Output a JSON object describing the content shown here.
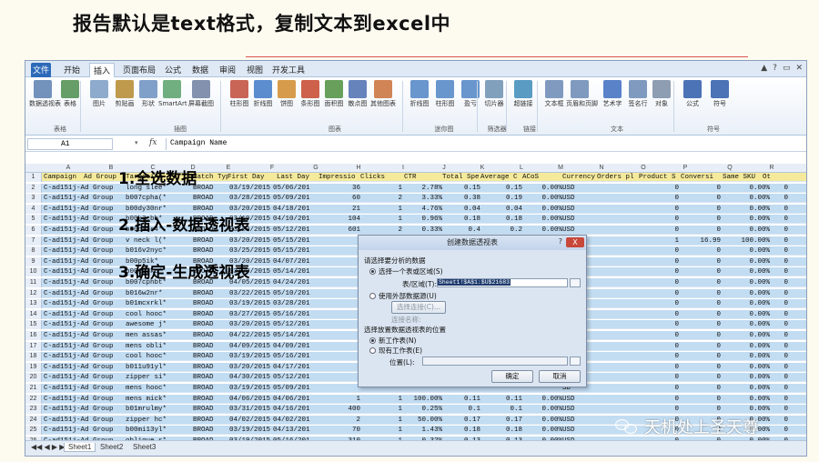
{
  "slide": {
    "title": "报告默认是text格式，复制文本到excel中",
    "steps": [
      "1.全选数据",
      "2.插入-数据透视表",
      "3.确定-生成透视表"
    ],
    "watermark": "天机处上圣天尊"
  },
  "ribbon": {
    "tabs": [
      "文件",
      "开始",
      "插入",
      "页面布局",
      "公式",
      "数据",
      "审阅",
      "视图",
      "开发工具"
    ],
    "active_tab": "插入",
    "buttons": [
      "数据透视表",
      "表格",
      "图片",
      "剪贴画",
      "形状",
      "SmartArt",
      "屏幕截图",
      "柱形图",
      "折线图",
      "饼图",
      "条形图",
      "面积图",
      "散点图",
      "其他图表",
      "折线图",
      "柱形图",
      "盈亏",
      "切片器",
      "超链接",
      "文本框",
      "页眉和页脚",
      "艺术字",
      "签名行",
      "对象",
      "公式",
      "符号"
    ],
    "groups": [
      "表格",
      "插图",
      "图表",
      "迷你图",
      "筛选器",
      "链接",
      "文本",
      "符号"
    ]
  },
  "formula_bar": {
    "name_box": "A1",
    "fx": "fx",
    "formula": "Campaign Name"
  },
  "columns": [
    "A",
    "B",
    "C",
    "D",
    "E",
    "F",
    "G",
    "H",
    "I",
    "J",
    "K",
    "L",
    "M",
    "N",
    "O",
    "P",
    "Q",
    "R"
  ],
  "header_row": [
    "Campaign",
    "Ad Group",
    "Targeting",
    "Match Typ",
    "First Day",
    "Last Day",
    "Impressio",
    "Clicks",
    "CTR",
    "Total Spe",
    "Average C",
    "ACoS",
    "Currency",
    "Orders pl",
    "Product S",
    "Conversi",
    "Same SKU",
    "Ot"
  ],
  "rows": [
    [
      "C-ad151j-Ad Group",
      "long slee*",
      "BROAD",
      "03/19/2015",
      "05/06/201",
      "36",
      "1",
      "2.78%",
      "0.15",
      "0.15",
      "0.00%",
      "USD",
      "0",
      "0",
      "0.00%",
      "0"
    ],
    [
      "C-ad151j-Ad Group",
      "b007cpha(*",
      "BROAD",
      "03/28/2015",
      "05/09/201",
      "60",
      "2",
      "3.33%",
      "0.38",
      "0.19",
      "0.00%",
      "USD",
      "0",
      "0",
      "0.00%",
      "0"
    ],
    [
      "C-ad151j-Ad Group",
      "b00dy30nr*",
      "BROAD",
      "03/20/2015",
      "04/18/201",
      "21",
      "1",
      "4.76%",
      "0.04",
      "0.04",
      "0.00%",
      "USD",
      "0",
      "0",
      "0.00%",
      "0"
    ],
    [
      "C-ad151j-Ad Group",
      "b00k3cbb*",
      "BROAD",
      "03/19/2015",
      "04/10/201",
      "104",
      "1",
      "0.96%",
      "0.18",
      "0.18",
      "0.00%",
      "USD",
      "0",
      "0",
      "0.00%",
      "0"
    ],
    [
      "C-ad151j-Ad Group",
      "b00cf5s4*",
      "BROAD",
      "03/20/2015",
      "05/12/201",
      "601",
      "2",
      "0.33%",
      "0.4",
      "0.2",
      "0.00%",
      "USD",
      "0",
      "0",
      "0.00%",
      "0"
    ],
    [
      "C-ad151j-Ad Group",
      "v neck l(*",
      "BROAD",
      "03/20/2015",
      "05/15/201",
      "",
      "",
      "",
      "",
      "",
      "",
      "SD",
      "1",
      "16.99",
      "100.00%",
      "0"
    ],
    [
      "C-ad151j-Ad Group",
      "b016v2nyc*",
      "BROAD",
      "03/25/2015",
      "05/15/201",
      "",
      "",
      "",
      "",
      "",
      "",
      "SD",
      "0",
      "0",
      "0.00%",
      "0"
    ],
    [
      "C-ad151j-Ad Group",
      "b00p5ik*",
      "BROAD",
      "03/20/2015",
      "04/07/201",
      "",
      "",
      "",
      "",
      "",
      "",
      "SD",
      "0",
      "0",
      "0.00%",
      "0"
    ],
    [
      "C-ad151j-Ad Group",
      "b00tc3kc*",
      "BROAD",
      "03/20/2015",
      "05/14/201",
      "",
      "",
      "",
      "",
      "",
      "",
      "SD",
      "0",
      "0",
      "0.00%",
      "0"
    ],
    [
      "C-ad151j-Ad Group",
      "b007cphbt*",
      "BROAD",
      "04/05/2015",
      "04/24/201",
      "",
      "",
      "",
      "",
      "",
      "",
      "SD",
      "0",
      "0",
      "0.00%",
      "0"
    ],
    [
      "C-ad151j-Ad Group",
      "b016w2nr*",
      "BROAD",
      "03/22/2015",
      "05/10/201",
      "",
      "",
      "",
      "",
      "",
      "",
      "SD",
      "0",
      "0",
      "0.00%",
      "0"
    ],
    [
      "C-ad151j-Ad Group",
      "b01mcxrkl*",
      "BROAD",
      "03/19/2015",
      "03/28/201",
      "",
      "",
      "",
      "",
      "",
      "",
      "SD",
      "0",
      "0",
      "0.00%",
      "0"
    ],
    [
      "C-ad151j-Ad Group",
      "cool hooc*",
      "BROAD",
      "03/27/2015",
      "05/16/201",
      "",
      "",
      "",
      "",
      "",
      "",
      "SD",
      "0",
      "0",
      "0.00%",
      "0"
    ],
    [
      "C-ad151j-Ad Group",
      "awesome j*",
      "BROAD",
      "03/20/2015",
      "05/12/201",
      "",
      "",
      "",
      "",
      "",
      "",
      "SD",
      "0",
      "0",
      "0.00%",
      "0"
    ],
    [
      "C-ad151j-Ad Group",
      "men assas*",
      "BROAD",
      "04/22/2015",
      "05/14/201",
      "",
      "",
      "",
      "",
      "",
      "",
      "SD",
      "0",
      "0",
      "0.00%",
      "0"
    ],
    [
      "C-ad151j-Ad Group",
      "mens obli*",
      "BROAD",
      "04/09/2015",
      "04/09/201",
      "",
      "",
      "",
      "",
      "",
      "",
      "SD",
      "0",
      "0",
      "0.00%",
      "0"
    ],
    [
      "C-ad151j-Ad Group",
      "cool hooc*",
      "BROAD",
      "03/19/2015",
      "05/16/201",
      "",
      "",
      "",
      "",
      "",
      "",
      "SD",
      "0",
      "0",
      "0.00%",
      "0"
    ],
    [
      "C-ad151j-Ad Group",
      "b011u91yl*",
      "BROAD",
      "03/20/2015",
      "04/17/201",
      "",
      "",
      "",
      "",
      "",
      "",
      "SD",
      "0",
      "0",
      "0.00%",
      "0"
    ],
    [
      "C-ad151j-Ad Group",
      "zipper si*",
      "BROAD",
      "04/30/2015",
      "05/12/201",
      "",
      "",
      "",
      "",
      "",
      "",
      "SD",
      "0",
      "0",
      "0.00%",
      "0"
    ],
    [
      "C-ad151j-Ad Group",
      "mens hooc*",
      "BROAD",
      "03/19/2015",
      "05/09/201",
      "",
      "",
      "",
      "",
      "",
      "",
      "SD",
      "0",
      "0",
      "0.00%",
      "0"
    ],
    [
      "C-ad151j-Ad Group",
      "mens mick*",
      "BROAD",
      "04/06/2015",
      "04/06/201",
      "1",
      "1",
      "100.00%",
      "0.11",
      "0.11",
      "0.00%",
      "USD",
      "0",
      "0",
      "0.00%",
      "0"
    ],
    [
      "C-ad151j-Ad Group",
      "b01mrulmy*",
      "BROAD",
      "03/31/2015",
      "04/16/201",
      "400",
      "1",
      "0.25%",
      "0.1",
      "0.1",
      "0.00%",
      "USD",
      "0",
      "0",
      "0.00%",
      "0"
    ],
    [
      "C-ad151j-Ad Group",
      "zipper hc*",
      "BROAD",
      "04/02/2015",
      "04/02/201",
      "2",
      "1",
      "50.00%",
      "0.17",
      "0.17",
      "0.00%",
      "USD",
      "0",
      "0",
      "0.00%",
      "0"
    ],
    [
      "C-ad151j-Ad Group",
      "b00mi13yl*",
      "BROAD",
      "03/19/2015",
      "04/13/201",
      "70",
      "1",
      "1.43%",
      "0.18",
      "0.18",
      "0.00%",
      "USD",
      "0",
      "0",
      "0.00%",
      "0"
    ],
    [
      "C-ad151j-Ad Group",
      "oblique s*",
      "BROAD",
      "03/19/2015",
      "05/16/201",
      "310",
      "1",
      "0.32%",
      "0.13",
      "0.13",
      "0.00%",
      "USD",
      "0",
      "0",
      "0.00%",
      "0"
    ]
  ],
  "sheets": [
    "Sheet1",
    "Sheet2",
    "Sheet3"
  ],
  "dialog": {
    "title": "创建数据透视表",
    "help": "?",
    "close": "X",
    "section1": "请选择要分析的数据",
    "radio_select_range": "选择一个表或区域(S)",
    "table_range_label": "表/区域(T):",
    "table_range_value": "Sheet1!$A$1:$U$21683",
    "radio_external": "使用外部数据源(U)",
    "choose_connection": "选择连接(C)...",
    "connection_name": "连接名称:",
    "section2": "选择放置数据透视表的位置",
    "radio_new_sheet": "新工作表(N)",
    "radio_existing_sheet": "现有工作表(E)",
    "location_label": "位置(L):",
    "ok": "确定",
    "cancel": "取消"
  }
}
